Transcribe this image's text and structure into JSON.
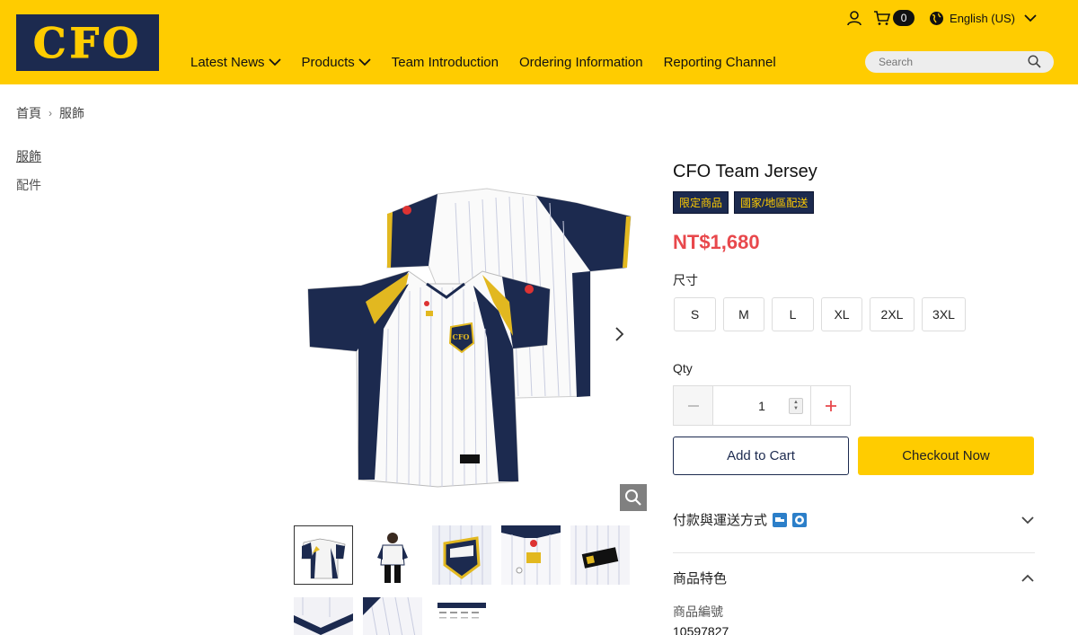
{
  "header": {
    "logo_text": "CFO",
    "nav": [
      {
        "label": "Latest News",
        "has_dropdown": true
      },
      {
        "label": "Products",
        "has_dropdown": true
      },
      {
        "label": "Team Introduction",
        "has_dropdown": false
      },
      {
        "label": "Ordering Information",
        "has_dropdown": false
      },
      {
        "label": "Reporting Channel",
        "has_dropdown": false
      }
    ],
    "cart_count": "0",
    "language": "English (US)",
    "search_placeholder": "Search"
  },
  "breadcrumb": {
    "home": "首頁",
    "current": "服飾"
  },
  "categories": [
    "服飾",
    "配件"
  ],
  "product": {
    "title": "CFO Team Jersey",
    "tags": [
      "限定商品",
      "國家/地區配送"
    ],
    "price": "NT$1,680",
    "size_label": "尺寸",
    "sizes": [
      "S",
      "M",
      "L",
      "XL",
      "2XL",
      "3XL"
    ],
    "qty_label": "Qty",
    "qty_value": "1",
    "add_to_cart": "Add to Cart",
    "checkout": "Checkout Now",
    "jersey_badge_text": "CFO"
  },
  "accordion": {
    "payment_shipping": "付款與運送方式",
    "features": "商品特色",
    "sku_label": "商品編號",
    "sku_value": "10597827"
  },
  "colors": {
    "brand_yellow": "#FFCC00",
    "brand_navy": "#1C2A4F",
    "price_red": "#E8484C"
  }
}
